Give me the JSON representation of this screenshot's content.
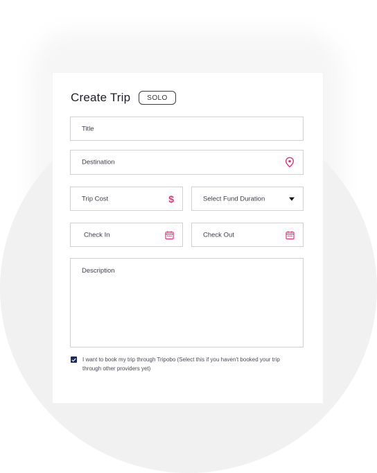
{
  "form": {
    "heading": "Create Trip",
    "badge": "SOLO",
    "fields": {
      "title": {
        "placeholder": "Title"
      },
      "destination": {
        "placeholder": "Destination",
        "icon": "location-pin-icon"
      },
      "trip_cost": {
        "placeholder": "Trip Cost",
        "icon": "dollar-icon"
      },
      "fund_duration": {
        "placeholder": "Select Fund Duration",
        "icon": "caret-down-icon"
      },
      "check_in": {
        "placeholder": "Check In",
        "icon": "calendar-icon"
      },
      "check_out": {
        "placeholder": "Check Out",
        "icon": "calendar-icon"
      },
      "description": {
        "placeholder": "Description"
      }
    },
    "booking_checkbox": {
      "checked": true,
      "label": "I want to book my trip through Tripobo (Select this if you haven't booked your trip through other providers yet)"
    }
  },
  "colors": {
    "accent": "#e8337b",
    "checkbox": "#1c2a5c",
    "border": "#cfcfd6"
  }
}
